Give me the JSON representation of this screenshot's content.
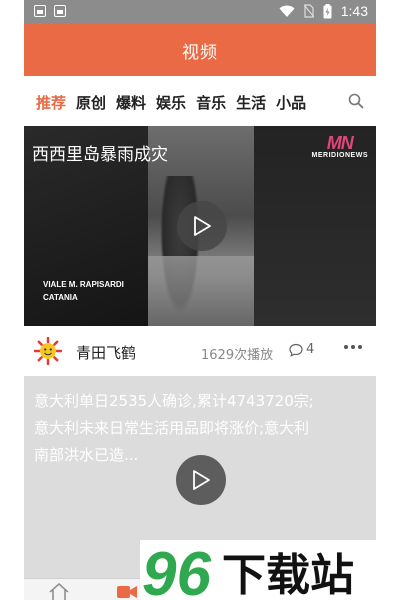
{
  "status_bar": {
    "time": "1:43"
  },
  "header": {
    "title": "视频"
  },
  "tabs": [
    {
      "label": "推荐",
      "active": true
    },
    {
      "label": "原创"
    },
    {
      "label": "爆料"
    },
    {
      "label": "娱乐"
    },
    {
      "label": "音乐"
    },
    {
      "label": "生活"
    },
    {
      "label": "小品"
    }
  ],
  "video1": {
    "title": "西西里岛暴雨成灾",
    "brand_logo": "MN",
    "brand_text": "MERIDIONEWS",
    "caption_line1": "VIALE M. RAPISARDI",
    "caption_line2": "CATANIA"
  },
  "author_row": {
    "name": "青田飞鹤",
    "plays": "1629次播放",
    "comments": "4"
  },
  "video2": {
    "text_lines": [
      "意大利单日2535人确诊,累计4743720宗;",
      "意大利未来日常生活用品即将涨价;意大利",
      "南部洪水已造..."
    ]
  },
  "watermark": {
    "number": "96",
    "text": "下载站"
  },
  "colors": {
    "accent": "#ea6a45",
    "status_bar": "#8c8c8c",
    "brand_pink": "#e0457b",
    "watermark_green": "#2fa84f"
  },
  "icons": {
    "search": "search-icon",
    "play": "play-icon",
    "comment": "comment-icon",
    "more": "more-icon",
    "home": "home-icon",
    "video": "video-icon"
  }
}
